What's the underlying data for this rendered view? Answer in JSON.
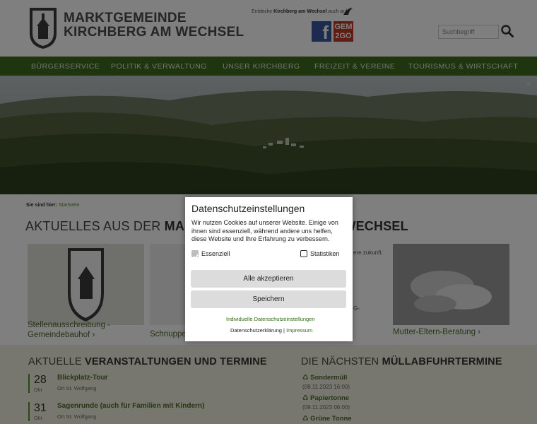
{
  "header": {
    "brand_line1": "MARKTGEMEINDE",
    "brand_line2": "KIRCHBERG AM WECHSEL",
    "tagline_pre": "Entdecke ",
    "tagline_bold": "Kirchberg am Wechsel",
    "tagline_post": " auch auf",
    "facebook_icon": "facebook-icon",
    "gem2go_label_1": "GEM",
    "gem2go_label_2": "2GO",
    "search_placeholder": "Suchbegriff",
    "search_icon": "search-icon"
  },
  "nav": {
    "items": [
      "BÜRGERSERVICE",
      "POLITIK & VERWALTUNG",
      "UNSER KIRCHBERG",
      "FREIZEIT & VEREINE",
      "TOURISMUS & WIRTSCHAFT"
    ]
  },
  "hero": {
    "close_label": "×"
  },
  "breadcrumb": {
    "label": "Sie sind hier:",
    "link": "Startseite"
  },
  "news": {
    "title_pre": "AKTUELLES AUS DER ",
    "title_bold_1": "MARK",
    "title_bold_2": "M WECHSEL",
    "cards": [
      {
        "caption_1": "Stellenausschreibung -",
        "caption_2": "Gemeindebauhof"
      },
      {
        "caption_1": "Schnuppe"
      },
      {
        "caption_1": "Mutter-Eltern-Beratung"
      }
    ],
    "teaser_1": "ere zukunft.",
    "teaser_2": "G-"
  },
  "events": {
    "title_pre": "AKTUELLE ",
    "title_bold": "VERANSTALTUNGEN UND TERMINE",
    "items": [
      {
        "day": "28",
        "month": "Okt",
        "title": "Blickplatz-Tour",
        "location": "Ort St. Wolfgang"
      },
      {
        "day": "31",
        "month": "Okt",
        "title": "Sagenrunde (auch für Familien mit Kindern)",
        "location": "Ort St. Wolfgang"
      }
    ]
  },
  "waste": {
    "title_pre": "DIE NÄCHSTEN ",
    "title_bold": "MÜLLABFUHRTERMINE",
    "items": [
      {
        "name": "Sondermüll",
        "date": "(08.11.2023 16:00)"
      },
      {
        "name": "Papiertonne",
        "date": "(09.11.2023 06:00)"
      },
      {
        "name": "Grüne Tonne",
        "date": ""
      }
    ]
  },
  "cookie": {
    "title": "Datenschutzeinstellungen",
    "description": "Wir nutzen Cookies auf unserer Website. Einige von ihnen sind essenziell, während andere uns helfen, diese Website und Ihre Erfahrung zu verbessern.",
    "essential_label": "Essenziell",
    "statistics_label": "Statistiken",
    "accept_all": "Alle akzeptieren",
    "save": "Speichern",
    "individual": "Individuelle Datenschutzeinstellungen",
    "privacy": "Datenschutzerklärung",
    "separator": " | ",
    "imprint": "Impressum"
  },
  "colors": {
    "nav_green": "#3f6b1e",
    "link_green": "#2e6b12",
    "band": "#efeede"
  }
}
